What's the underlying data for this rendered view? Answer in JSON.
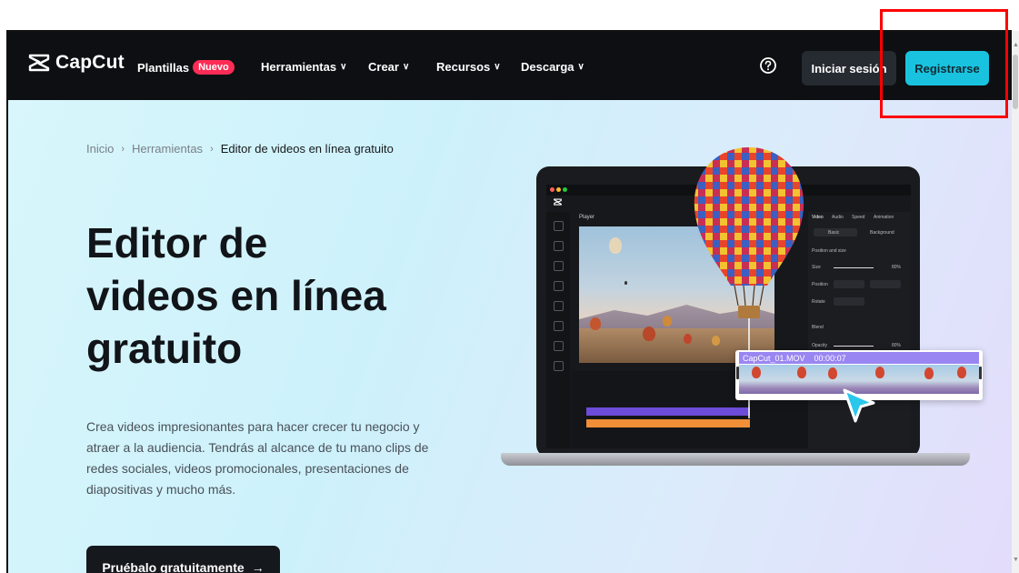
{
  "nav": {
    "logo_text": "CapCut",
    "items": [
      {
        "label": "Plantillas",
        "badge": "Nuevo"
      },
      {
        "label": "Herramientas"
      },
      {
        "label": "Crear"
      },
      {
        "label": "Recursos"
      },
      {
        "label": "Descarga"
      }
    ],
    "login_label": "Iniciar sesión",
    "register_label": "Registrarse"
  },
  "breadcrumb": {
    "home": "Inicio",
    "section": "Herramientas",
    "current": "Editor de videos en línea gratuito"
  },
  "hero": {
    "title_line1": "Editor de",
    "title_line2": "videos en línea",
    "title_line3": "gratuito",
    "description": "Crea videos impresionantes para hacer crecer tu negocio y atraer a la audiencia. Tendrás al alcance de tu mano clips de redes sociales, videos promocionales, presentaciones de diapositivas y mucho más.",
    "cta_label": "Pruébalo gratuitamente"
  },
  "editor_mock": {
    "player_label": "Player",
    "tabs": [
      "Video",
      "Audio",
      "Speed",
      "Animation"
    ],
    "subtabs": [
      "Basic",
      "Background"
    ],
    "position_label": "Position and size",
    "size_label": "Size",
    "size_value": "80%",
    "position_label2": "Position",
    "rotate_label": "Rotate",
    "blend_label": "Blend",
    "opacity_label": "Opacity",
    "opacity_value": "80%",
    "clip_name": "CapCut_01.MOV",
    "clip_time": "00:00:07"
  },
  "colors": {
    "nav_bg": "#0d0f12",
    "accent": "#19c3e0",
    "badge": "#fe2c55",
    "highlight": "#ff0000"
  }
}
